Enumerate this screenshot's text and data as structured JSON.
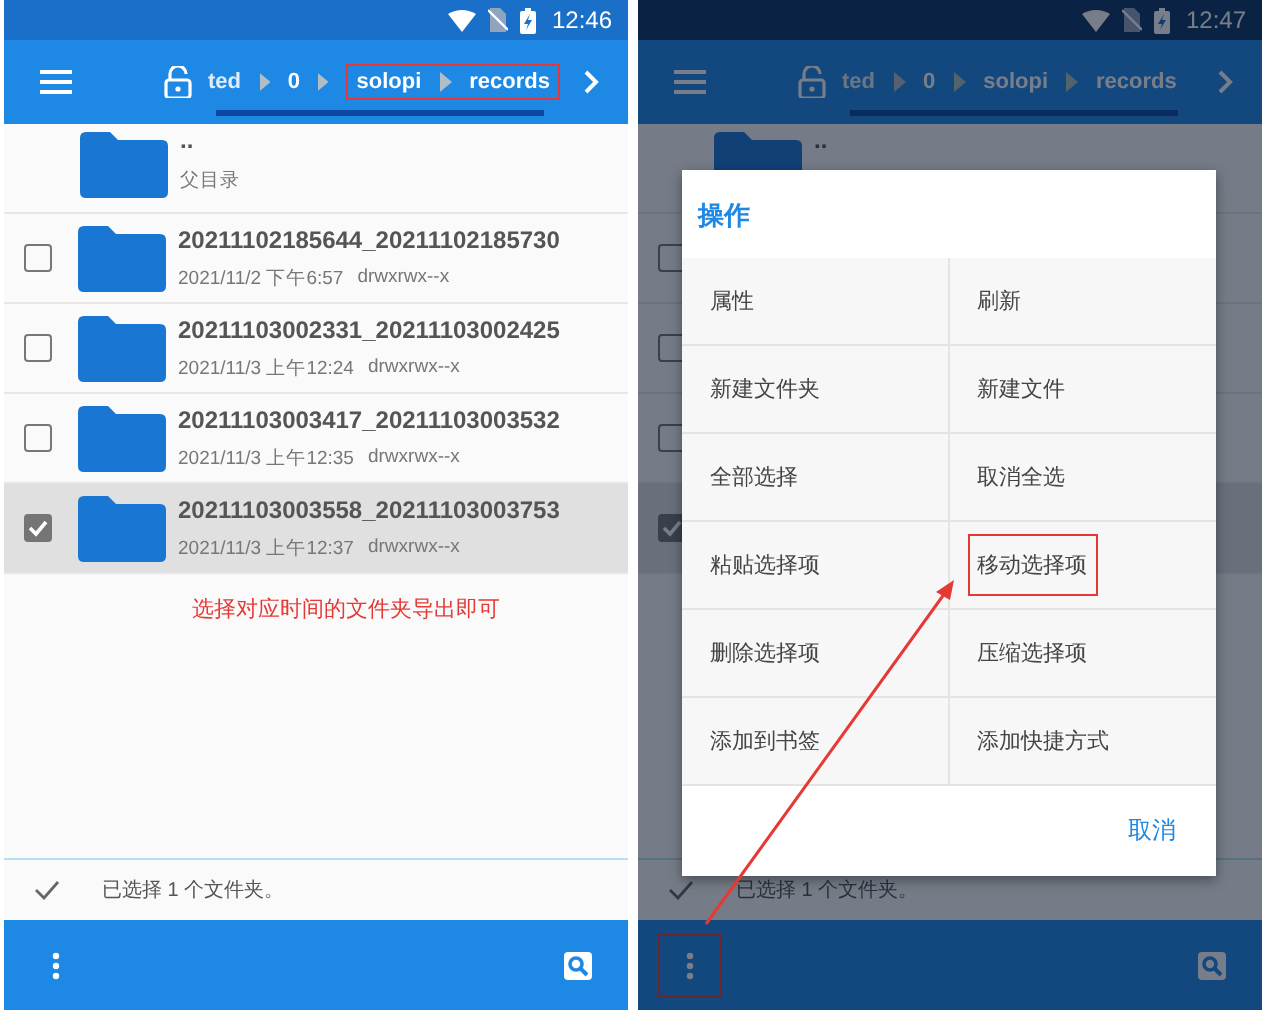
{
  "screens": [
    {
      "status_bar": {
        "time": "12:46"
      },
      "dimmed": false,
      "menu_highlighted": false,
      "breadcrumb": [
        {
          "label": "ted",
          "highlighted": false
        },
        {
          "label": "0",
          "highlighted": false
        },
        {
          "label": "solopi",
          "highlighted": true
        },
        {
          "label": "records",
          "highlighted": true
        }
      ],
      "parent": {
        "name": "..",
        "caption": "父目录"
      },
      "rows": [
        {
          "name": "20211102185644_20211102185730",
          "date": "2021/11/2 下午6:57",
          "permissions": "drwxrwx--x",
          "checked": false
        },
        {
          "name": "20211103002331_20211103002425",
          "date": "2021/11/3 上午12:24",
          "permissions": "drwxrwx--x",
          "checked": false
        },
        {
          "name": "20211103003417_20211103003532",
          "date": "2021/11/3 上午12:35",
          "permissions": "drwxrwx--x",
          "checked": false
        },
        {
          "name": "20211103003558_20211103003753",
          "date": "2021/11/3 上午12:37",
          "permissions": "drwxrwx--x",
          "checked": true
        }
      ],
      "note": "选择对应时间的文件夹导出即可",
      "selection_text": "已选择 1 个文件夹。"
    },
    {
      "status_bar": {
        "time": "12:47"
      },
      "dimmed": true,
      "menu_highlighted": true,
      "breadcrumb": [
        {
          "label": "ted",
          "highlighted": false
        },
        {
          "label": "0",
          "highlighted": false
        },
        {
          "label": "solopi",
          "highlighted": false
        },
        {
          "label": "records",
          "highlighted": false
        }
      ],
      "parent": {
        "name": ".."
      },
      "rows": [
        {
          "checked": false
        },
        {
          "checked": false
        },
        {
          "checked": false
        },
        {
          "checked": true
        }
      ],
      "selection_text": "已选择 1 个文件夹。",
      "dialog": {
        "title": "操作",
        "actions": [
          {
            "label": "属性",
            "highlighted": false
          },
          {
            "label": "刷新",
            "highlighted": false
          },
          {
            "label": "新建文件夹",
            "highlighted": false
          },
          {
            "label": "新建文件",
            "highlighted": false
          },
          {
            "label": "全部选择",
            "highlighted": false
          },
          {
            "label": "取消全选",
            "highlighted": false
          },
          {
            "label": "粘贴选择项",
            "highlighted": false
          },
          {
            "label": "移动选择项",
            "highlighted": true
          },
          {
            "label": "删除选择项",
            "highlighted": false
          },
          {
            "label": "压缩选择项",
            "highlighted": false
          },
          {
            "label": "添加到书签",
            "highlighted": false
          },
          {
            "label": "添加快捷方式",
            "highlighted": false
          }
        ],
        "cancel": "取消"
      },
      "arrow": true
    }
  ]
}
